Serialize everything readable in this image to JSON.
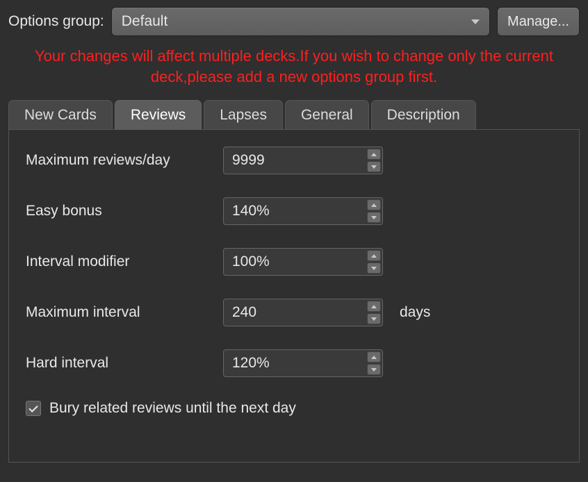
{
  "header": {
    "options_group_label": "Options group:",
    "selected_group": "Default",
    "manage_label": "Manage..."
  },
  "warning_text": "Your changes will affect multiple decks.If you wish to change only the current deck,please add a new options group first.",
  "tabs": [
    {
      "label": "New Cards",
      "active": false
    },
    {
      "label": "Reviews",
      "active": true
    },
    {
      "label": "Lapses",
      "active": false
    },
    {
      "label": "General",
      "active": false
    },
    {
      "label": "Description",
      "active": false
    }
  ],
  "fields": {
    "max_reviews": {
      "label": "Maximum reviews/day",
      "value": "9999"
    },
    "easy_bonus": {
      "label": "Easy bonus",
      "value": "140%"
    },
    "interval_modifier": {
      "label": "Interval modifier",
      "value": "100%"
    },
    "max_interval": {
      "label": "Maximum interval",
      "value": "240",
      "suffix": "days"
    },
    "hard_interval": {
      "label": "Hard interval",
      "value": "120%"
    }
  },
  "bury": {
    "checked": true,
    "label": "Bury related reviews until the next day"
  }
}
